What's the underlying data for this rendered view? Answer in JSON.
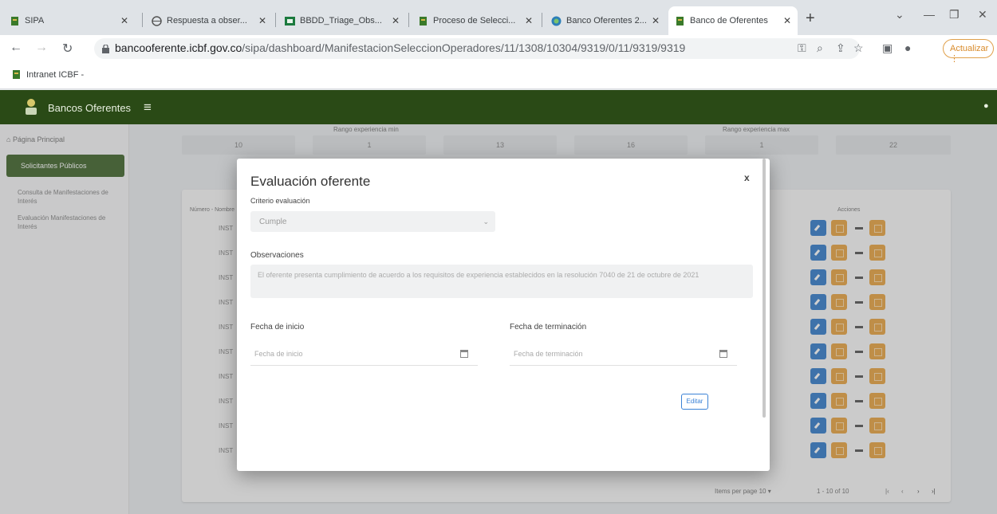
{
  "browser": {
    "tabs": [
      {
        "label": "SIPA",
        "icon": "icbf-favicon"
      },
      {
        "label": "Respuesta a obser...",
        "icon": "globe-icon"
      },
      {
        "label": "BBDD_Triage_Obs...",
        "icon": "sheets-favicon"
      },
      {
        "label": "Proceso de Selecci...",
        "icon": "icbf-favicon"
      },
      {
        "label": "Banco Oferentes 2...",
        "icon": "app-favicon"
      },
      {
        "label": "Banco de Oferentes",
        "icon": "icbf-favicon"
      }
    ],
    "url_host": "bancooferente.icbf.gov.co",
    "url_path": "/sipa/dashboard/ManifestacionSeleccionOperadores/11/1308/10304/9319/0/11/9319/9319",
    "update_label": "Actualizar",
    "bookmark": "Intranet ICBF -"
  },
  "app": {
    "name": "Bancos Oferentes",
    "sidebar": {
      "home": "Página Principal",
      "active": "Solicitantes Públicos",
      "sub1": "Consulta de Manifestaciones de Interés",
      "sub2": "Evaluación Manifestaciones de Interés"
    },
    "stats": {
      "label_left": "Rango experiencia min",
      "label_right": "Rango experiencia max",
      "values": [
        "10",
        "1",
        "13",
        "16",
        "1",
        "22"
      ]
    },
    "table": {
      "col_left": "Número - Nombre",
      "col_actions": "Acciones",
      "row_prefix": "INST",
      "pager_label": "Items per page",
      "pager_value": "10",
      "pager_range": "1 - 10 of 10"
    }
  },
  "modal": {
    "title": "Evaluación oferente",
    "criterion_label": "Criterio evaluación",
    "criterion_value": "Cumple",
    "observations_label": "Observaciones",
    "observations_value": "El oferente presenta cumplimiento de acuerdo a los requisitos de experiencia establecidos en la resolución 7040 de 21 de octubre de 2021",
    "start_label": "Fecha de inicio",
    "start_placeholder": "Fecha de inicio",
    "end_label": "Fecha de terminación",
    "end_placeholder": "Fecha de terminación",
    "edit_button": "Editar",
    "close_label": "x"
  }
}
